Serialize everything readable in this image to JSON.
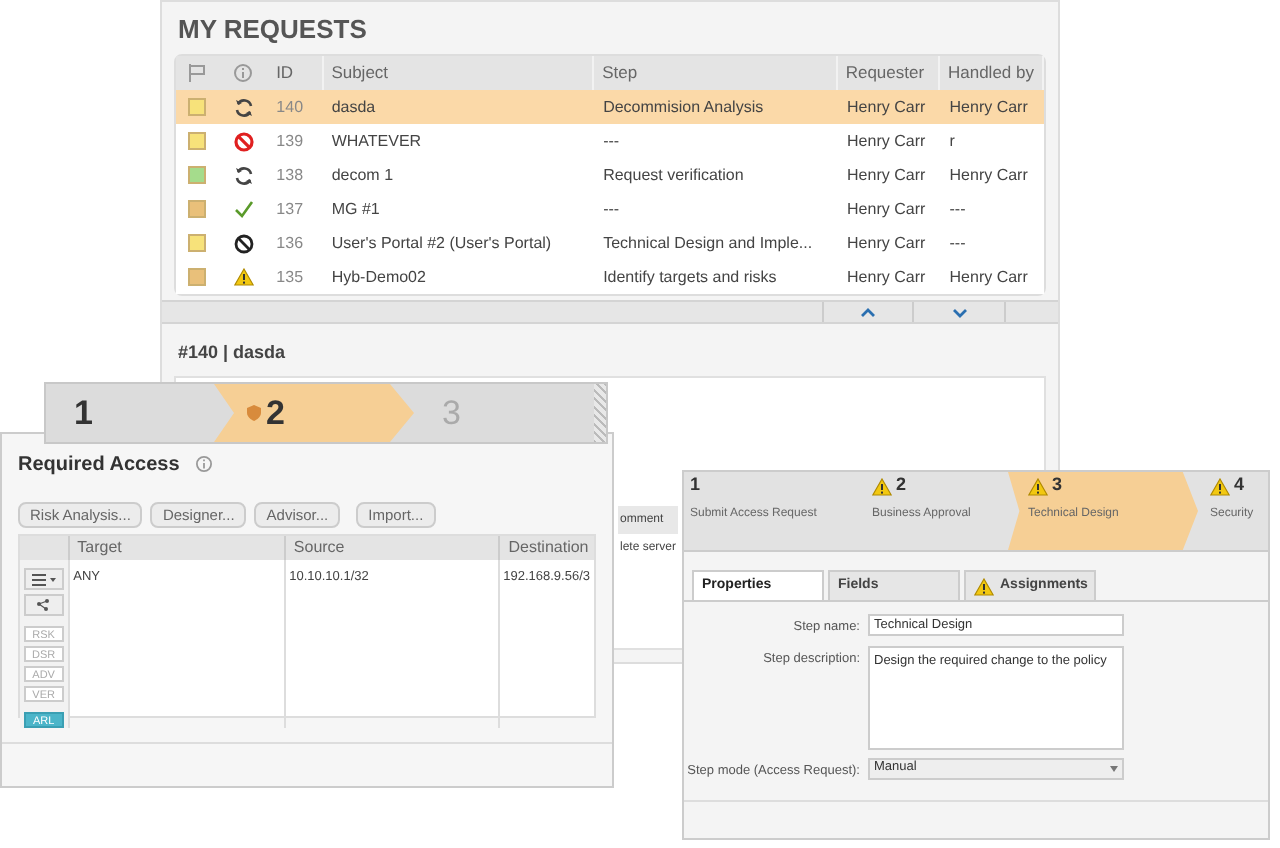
{
  "requests": {
    "title": "MY REQUESTS",
    "columns": [
      "ID",
      "Subject",
      "Step",
      "Requester",
      "Handled by"
    ],
    "rows": [
      {
        "color": "#f7e27a",
        "kind": "cycle",
        "id": "140",
        "subject": "dasda",
        "step": "Decommision Analysis",
        "requester": "Henry Carr",
        "handled_by": "Henry Carr",
        "selected": true
      },
      {
        "color": "#f7e27a",
        "kind": "blocked",
        "id": "139",
        "subject": "WHATEVER",
        "step": "---",
        "requester": "Henry Carr",
        "handled_by": "r",
        "selected": false
      },
      {
        "color": "#a5dc8c",
        "kind": "cycle",
        "id": "138",
        "subject": "decom 1",
        "step": "Request verification",
        "requester": "Henry Carr",
        "handled_by": "Henry Carr",
        "selected": false
      },
      {
        "color": "#e9c07a",
        "kind": "check",
        "id": "137",
        "subject": "MG #1",
        "step": "---",
        "requester": "Henry Carr",
        "handled_by": "---",
        "selected": false
      },
      {
        "color": "#f7e27a",
        "kind": "cancelled",
        "id": "136",
        "subject": "User's Portal #2 (User's Portal)",
        "step": "Technical Design and Imple...",
        "requester": "Henry Carr",
        "handled_by": "---",
        "selected": false
      },
      {
        "color": "#e9c07a",
        "kind": "warning",
        "id": "135",
        "subject": "Hyb-Demo02",
        "step": "Identify targets and risks",
        "requester": "Henry Carr",
        "handled_by": "Henry Carr",
        "selected": false
      }
    ],
    "detail_title": "#140 | dasda",
    "hidden_column": "omment",
    "hidden_cell": "lete server"
  },
  "access_window": {
    "steps": [
      {
        "label": "1",
        "selected": false,
        "disabled": false,
        "icon": false
      },
      {
        "label": "2",
        "selected": true,
        "disabled": false,
        "icon": true
      },
      {
        "label": "3",
        "selected": false,
        "disabled": true,
        "icon": false
      }
    ],
    "title": "Required Access",
    "buttons": [
      "Risk Analysis...",
      "Designer...",
      "Advisor...",
      "Import..."
    ],
    "columns": [
      "Target",
      "Source",
      "Destination"
    ],
    "row": [
      "ANY",
      "10.10.10.1/32",
      "192.168.9.56/3"
    ],
    "side_buttons": [
      {
        "label": "RSK",
        "selected": false
      },
      {
        "label": "DSR",
        "selected": false
      },
      {
        "label": "ADV",
        "selected": false
      },
      {
        "label": "VER",
        "selected": false
      },
      {
        "label": "ARL",
        "selected": true
      }
    ]
  },
  "workflow_window": {
    "steps": [
      {
        "number": "1",
        "name": "Submit Access Request",
        "warning": false,
        "selected": false
      },
      {
        "number": "2",
        "name": "Business Approval",
        "warning": true,
        "selected": false
      },
      {
        "number": "3",
        "name": "Technical Design",
        "warning": true,
        "selected": true
      },
      {
        "number": "4",
        "name": "Security",
        "warning": true,
        "selected": false
      }
    ],
    "tabs": [
      {
        "label": "Properties",
        "selected": true,
        "warning": false
      },
      {
        "label": "Fields",
        "selected": false,
        "warning": false
      },
      {
        "label": "Assignments",
        "selected": false,
        "warning": true
      }
    ],
    "fields": [
      {
        "kind": "text",
        "label": "Step name:",
        "value": "Technical Design"
      },
      {
        "kind": "textarea",
        "label": "Step description:",
        "value": "Design the required change to the policy"
      },
      {
        "kind": "select",
        "label": "Step mode (Access Request):",
        "value": "Manual"
      }
    ]
  }
}
